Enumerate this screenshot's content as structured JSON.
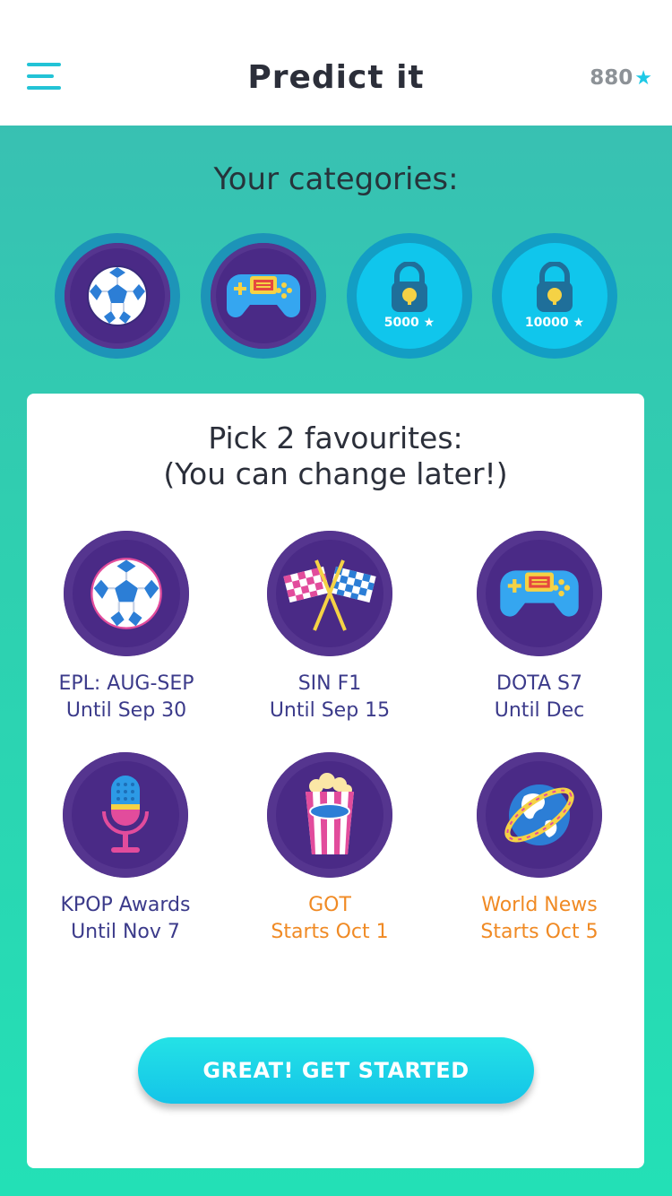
{
  "header": {
    "title": "Predict it",
    "points": "880",
    "colors": {
      "accent": "#22c3d6",
      "title": "#2c2f3a",
      "points": "#8d9297"
    }
  },
  "categories": {
    "heading": "Your categories:",
    "items": [
      {
        "icon": "soccer-ball-icon",
        "locked": false
      },
      {
        "icon": "gamepad-icon",
        "locked": false
      },
      {
        "icon": "padlock-icon",
        "locked": true,
        "cost": "5000"
      },
      {
        "icon": "padlock-icon",
        "locked": true,
        "cost": "10000"
      }
    ]
  },
  "card": {
    "title_line1": "Pick 2 favourites:",
    "title_line2": "(You can change later!)",
    "favourites": [
      {
        "icon": "soccer-ball-icon",
        "name": "EPL: AUG-SEP",
        "subtitle": "Until Sep 30",
        "status": "active"
      },
      {
        "icon": "checkered-flags-icon",
        "name": "SIN F1",
        "subtitle": "Until Sep 15",
        "status": "active"
      },
      {
        "icon": "gamepad-icon",
        "name": "DOTA S7",
        "subtitle": "Until Dec",
        "status": "active"
      },
      {
        "icon": "microphone-icon",
        "name": "KPOP Awards",
        "subtitle": "Until Nov 7",
        "status": "active"
      },
      {
        "icon": "popcorn-icon",
        "name": "GOT",
        "subtitle": "Starts Oct 1",
        "status": "upcoming"
      },
      {
        "icon": "globe-icon",
        "name": "World News",
        "subtitle": "Starts Oct 5",
        "status": "upcoming"
      }
    ],
    "cta_label": "GREAT! GET STARTED"
  },
  "colors": {
    "purple": "#4a2a86",
    "active_label": "#3b3a8a",
    "upcoming_label": "#f08a24",
    "cta": "#14c4e8"
  }
}
